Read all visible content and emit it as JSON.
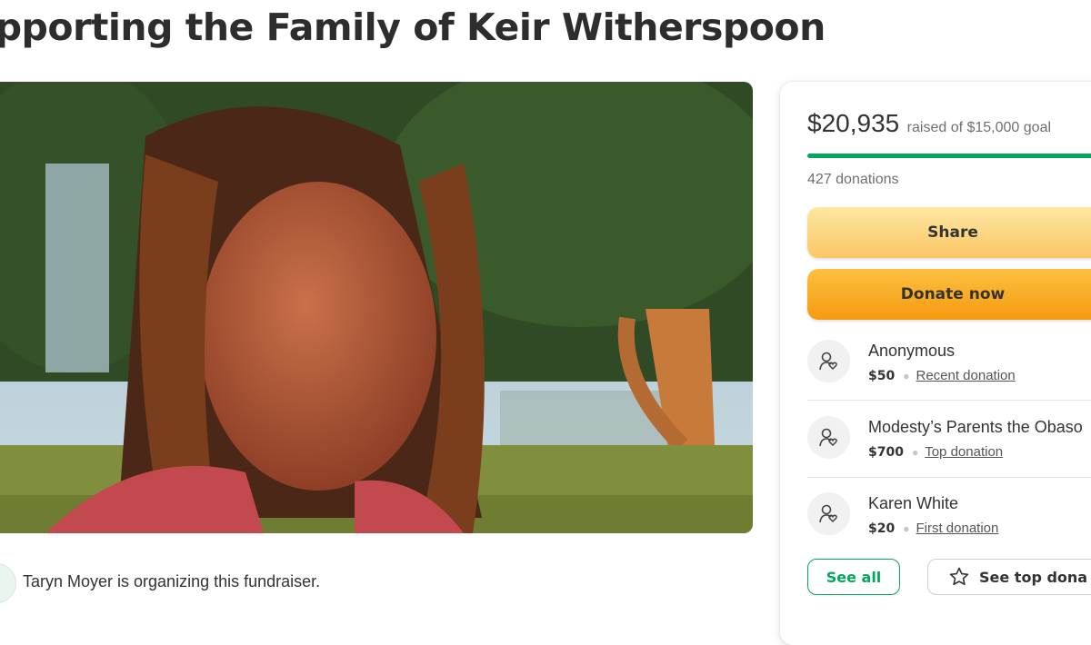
{
  "page": {
    "title": "upporting the Family of Keir Witherspoon"
  },
  "organizer": {
    "text": "Taryn Moyer is organizing this fundraiser."
  },
  "donation_card": {
    "raised_amount": "$20,935",
    "goal_text": "raised of $15,000 goal",
    "progress_fraction": 1.0,
    "donations_count": "427 donations",
    "share_label": "Share",
    "donate_label": "Donate now",
    "donors": [
      {
        "name": "Anonymous",
        "amount": "$50",
        "tag": "Recent donation"
      },
      {
        "name": "Modesty’s Parents the Obaso",
        "amount": "$700",
        "tag": "Top donation"
      },
      {
        "name": "Karen White",
        "amount": "$20",
        "tag": "First donation"
      }
    ],
    "see_all_label": "See all",
    "see_top_label": "See top dona"
  },
  "colors": {
    "brand_green": "#02a95c",
    "share_button": "#fbc665",
    "donate_button": "#f79a12"
  },
  "icons": [
    "heart-hand-icon",
    "star-icon"
  ]
}
